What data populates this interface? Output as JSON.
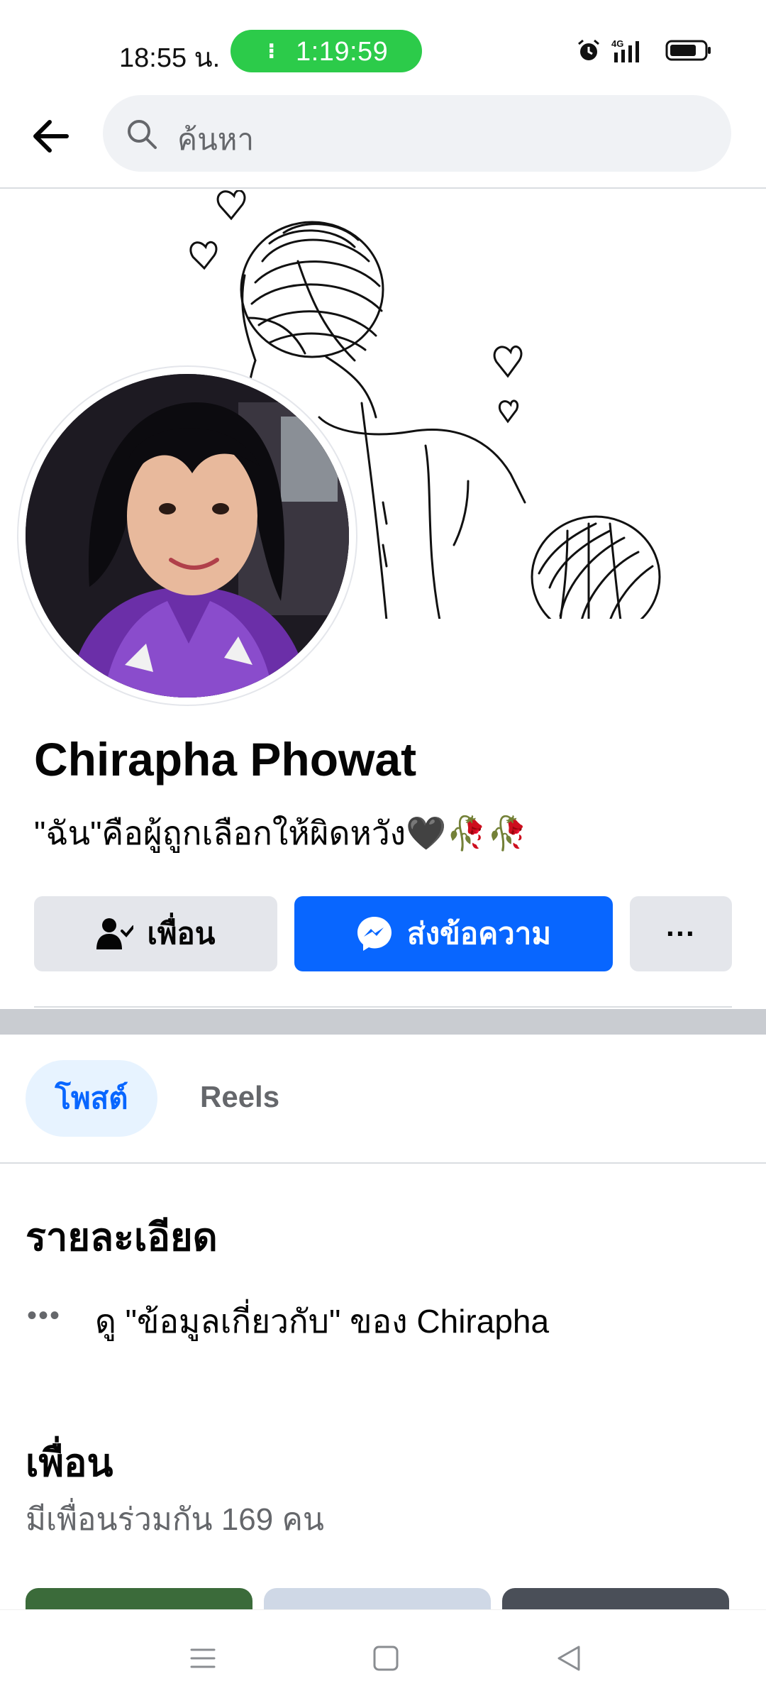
{
  "status_bar": {
    "time": "18:55 น.",
    "call_timer": "1:19:59",
    "network": "4G"
  },
  "header": {
    "search_placeholder": "ค้นหา"
  },
  "profile": {
    "name": "Chirapha Phowat",
    "bio": "\"ฉัน\"คือผู้ถูกเลือกให้ผิดหวัง🖤🥀🥀"
  },
  "actions": {
    "friends_label": "เพื่อน",
    "message_label": "ส่งข้อความ",
    "more_label": "···"
  },
  "tabs": [
    {
      "label": "โพสต์",
      "active": true
    },
    {
      "label": "Reels",
      "active": false
    }
  ],
  "details": {
    "title": "รายละเอียด",
    "about_link": "ดู \"ข้อมูลเกี่ยวกับ\" ของ Chirapha"
  },
  "friends": {
    "title": "เพื่อน",
    "mutual": "มีเพื่อนร่วมกัน 169 คน"
  },
  "colors": {
    "accent": "#0866ff",
    "call_green": "#2ccb4a",
    "button_gray": "#e4e6eb",
    "secondary_text": "#65676b"
  }
}
